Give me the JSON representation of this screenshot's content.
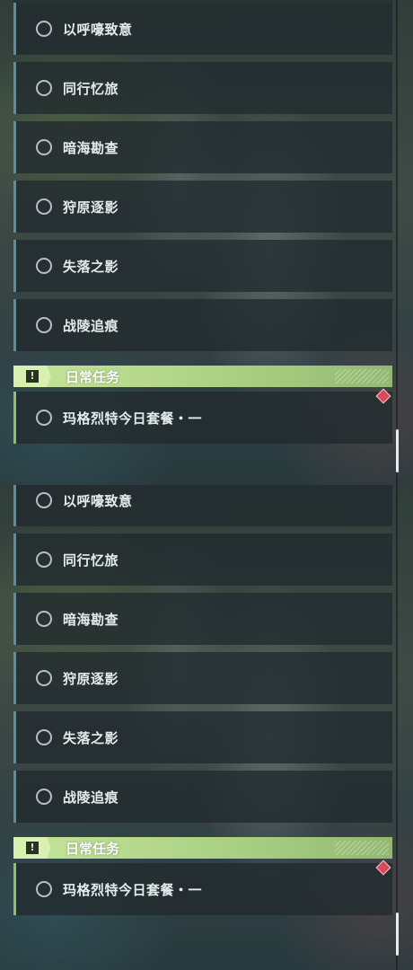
{
  "quest_list": {
    "items": [
      {
        "label": "以呼嚎致意"
      },
      {
        "label": "同行忆旅"
      },
      {
        "label": "暗海勘查"
      },
      {
        "label": "狩原逐影"
      },
      {
        "label": "失落之影"
      },
      {
        "label": "战陵追痕"
      }
    ]
  },
  "daily_category": {
    "title": "日常任务",
    "badge_icon": "exclamation-icon",
    "items": [
      {
        "label": "玛格烈特今日套餐・一",
        "tracked_icon": "red-diamond-icon"
      }
    ]
  },
  "colors": {
    "accent_green": "#a9cf83",
    "quest_border": "#5d8d9c",
    "tracked_marker": "#d84a5a"
  }
}
